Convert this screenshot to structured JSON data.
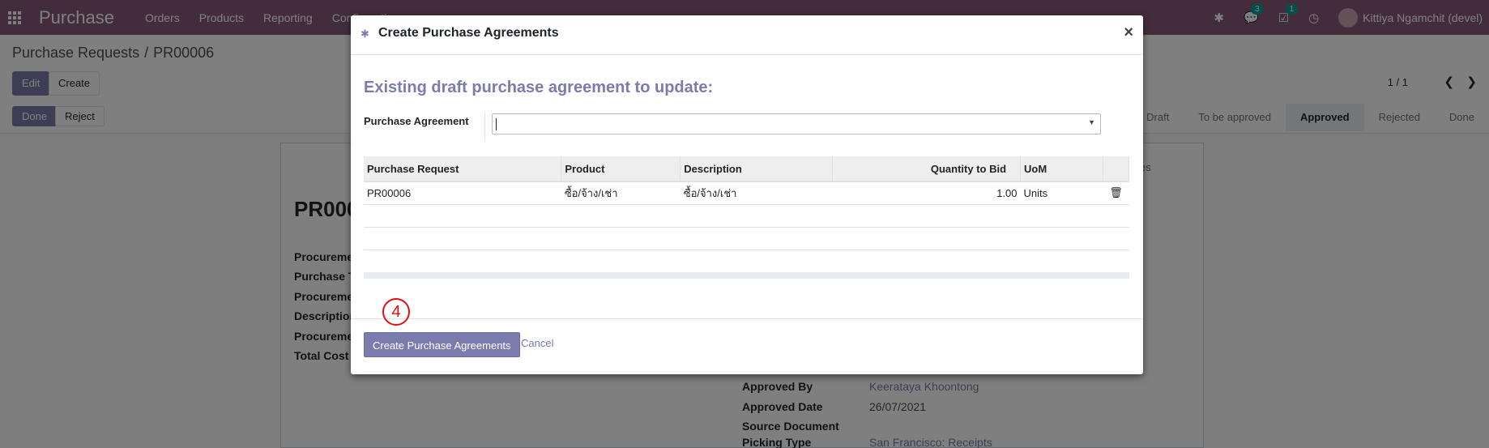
{
  "navbar": {
    "app_name": "Purchase",
    "menu": [
      "Orders",
      "Products",
      "Reporting",
      "Configuration"
    ],
    "messages_count": "3",
    "activities_count": "1",
    "user_name": "Kittiya Ngamchit (devel)"
  },
  "breadcrumb": {
    "parent": "Purchase Requests",
    "current": "PR00006"
  },
  "control": {
    "edit_label": "Edit",
    "create_label": "Create",
    "done_label": "Done",
    "reject_label": "Reject",
    "pager": "1 / 1"
  },
  "status_bar": [
    "Draft",
    "To be approved",
    "Approved",
    "Rejected",
    "Done"
  ],
  "status_active": "Approved",
  "form": {
    "title": "PR000",
    "labels": [
      "Procuremen",
      "Purchase T",
      "Procuremen",
      "Description",
      "Procuremen",
      "Total Cost"
    ],
    "tab_hint": "es",
    "approved_by_label": "Approved By",
    "approved_by_value": "Keerataya Khoontong",
    "approved_date_label": "Approved Date",
    "approved_date_value": "26/07/2021",
    "source_document_label": "Source Document",
    "picking_type_label": "Picking Type",
    "picking_type_value": "San Francisco: Receipts"
  },
  "modal": {
    "title": "Create Purchase Agreements",
    "section_title": "Existing draft purchase agreement to update:",
    "purchase_agreement_label": "Purchase Agreement",
    "purchase_agreement_value": "",
    "columns": [
      "Purchase Request",
      "Product",
      "Description",
      "Quantity to Bid",
      "UoM"
    ],
    "rows": [
      {
        "purchase_request": "PR00006",
        "product": "ซื้อ/จ้าง/เช่า",
        "description": "ซื้อ/จ้าง/เช่า",
        "quantity": "1.00",
        "uom": "Units"
      }
    ],
    "primary_button": "Create Purchase Agreements",
    "cancel_button": "Cancel",
    "step_marker": "4"
  }
}
